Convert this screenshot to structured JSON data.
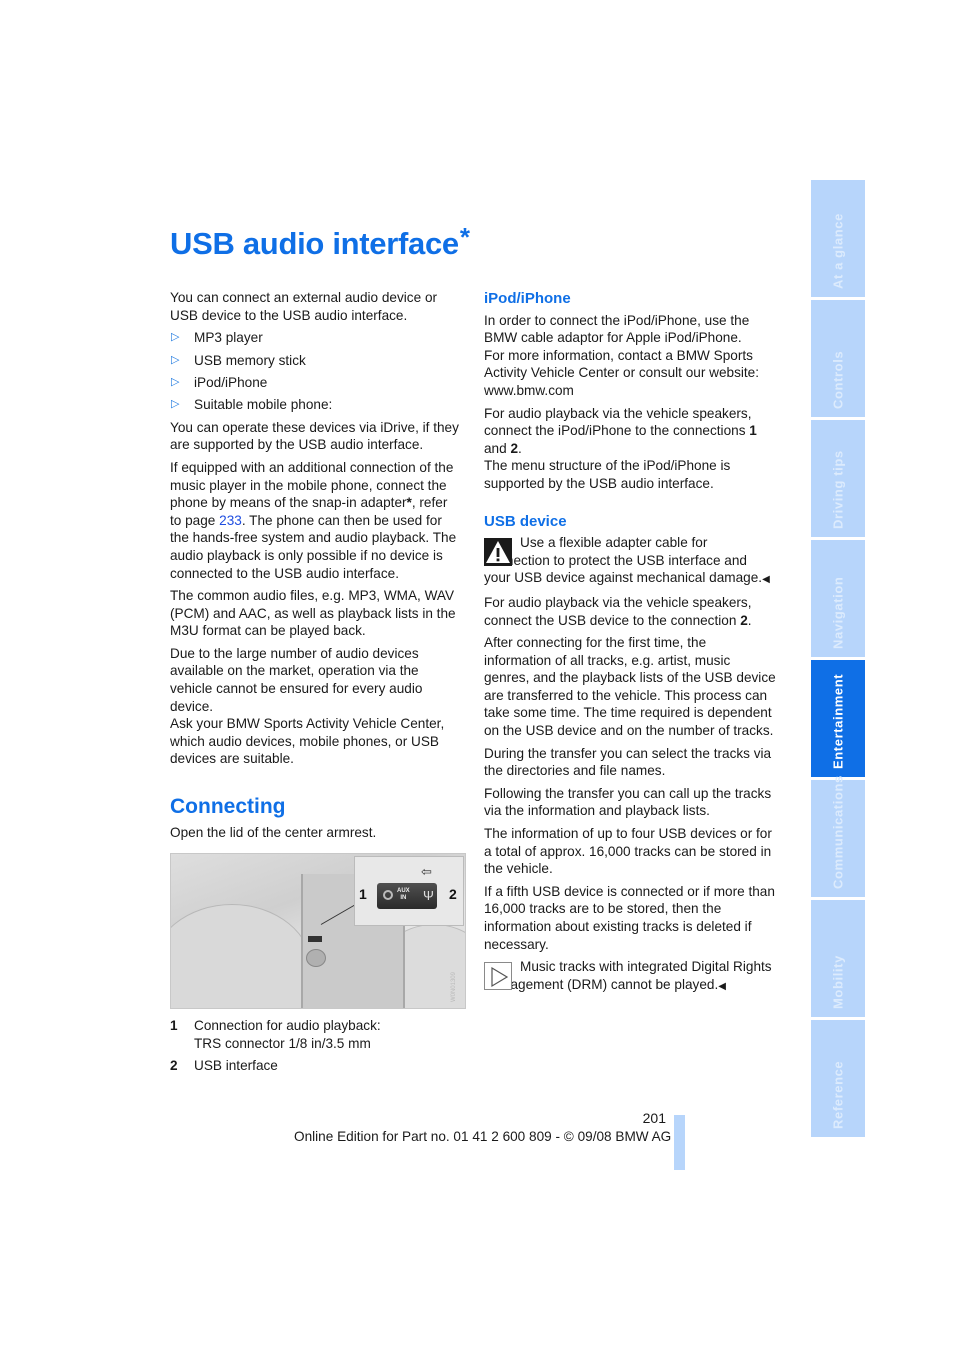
{
  "page": {
    "title": "USB audio interface",
    "title_star": "*",
    "page_number": "201",
    "footer": "Online Edition for Part no. 01 41 2 600 809 - © 09/08 BMW AG"
  },
  "colors": {
    "accent": "#0f6fe6",
    "tab_inactive": "#b7d5fb",
    "link": "#1f4de0"
  },
  "left": {
    "intro": "You can connect an external audio device or USB device to the USB audio interface.",
    "bullets": [
      "MP3 player",
      "USB memory stick",
      "iPod/iPhone",
      "Suitable mobile phone:"
    ],
    "bullet_icon": "triangle-right-icon",
    "p_idrive": "You can operate these devices via iDrive, if they are supported by the USB audio interface.",
    "p_adapter_1": "If equipped with an additional connection of the music player in the mobile phone, connect the phone by means of the snap-in adapter",
    "p_adapter_star": "*",
    "p_adapter_2": ", refer to page ",
    "p_adapter_link": "233",
    "p_adapter_3": ". The phone can then be used for the hands-free system and audio playback. The audio playback is only possible if no device is connected to the USB audio interface.",
    "p_formats": "The common audio files, e.g. MP3, WMA, WAV (PCM) and AAC, as well as playback lists in the M3U format can be played back.",
    "p_devices": "Due to the large number of audio devices available on the market, operation via the vehicle cannot be ensured for every audio device.",
    "p_devices_2": "Ask your BMW Sports Activity Vehicle Center, which audio devices, mobile phones, or USB devices are suitable.",
    "connecting_heading": "Connecting",
    "connecting_text": "Open the lid of the center armrest.",
    "figure": {
      "label_1": "1",
      "label_2": "2",
      "panel_text_1": "AUX",
      "panel_text_2": "IN",
      "usb_symbol": "Ψ",
      "image_code": "W0N01309"
    },
    "legend": [
      {
        "num": "1",
        "text": "Connection for audio playback:",
        "text2": "TRS connector 1/8 in/3.5 mm"
      },
      {
        "num": "2",
        "text": "USB interface"
      }
    ]
  },
  "right": {
    "ipod_heading": "iPod/iPhone",
    "ipod_p1": "In order to connect the iPod/iPhone, use the BMW cable adaptor for Apple iPod/iPhone.",
    "ipod_p1b": "For more information, contact a BMW Sports Activity Vehicle Center or consult our website: www.bmw.com",
    "ipod_p2_a": "For audio playback via the vehicle speakers, connect the iPod/iPhone to the connections ",
    "ipod_p2_b1": "1",
    "ipod_p2_and": " and ",
    "ipod_p2_b2": "2",
    "ipod_p2_end": ".",
    "ipod_p3": "The menu structure of the iPod/iPhone is supported by the USB audio interface.",
    "usb_heading": "USB device",
    "usb_warning": "Use a flexible adapter cable for connection to protect the USB interface and your USB device against mechanical damage.",
    "end_mark": "◀",
    "usb_p1_a": "For audio playback via the vehicle speakers, connect the USB device to the connection ",
    "usb_p1_b": "2",
    "usb_p1_end": ".",
    "usb_p2": "After connecting for the first time, the information of all tracks, e.g. artist, music genres, and the playback lists of the USB device are transferred to the vehicle. This process can take some time. The time required is dependent on the USB device and on the number of tracks.",
    "usb_p3": "During the transfer you can select the tracks via the directories and file names.",
    "usb_p4": "Following the transfer you can call up the tracks via the information and playback lists.",
    "usb_p5": "The information of up to four USB devices or for a total of approx. 16,000 tracks can be stored in the vehicle.",
    "usb_p6": "If a fifth USB device is connected or if more than 16,000 tracks are to be stored, then the information about existing tracks is deleted if necessary.",
    "usb_note": "Music tracks with integrated Digital Rights Management (DRM) cannot be played."
  },
  "sidebar": {
    "tabs": [
      {
        "label": "At a glance",
        "active": false
      },
      {
        "label": "Controls",
        "active": false
      },
      {
        "label": "Driving tips",
        "active": false
      },
      {
        "label": "Navigation",
        "active": false
      },
      {
        "label": "Entertainment",
        "active": true
      },
      {
        "label": "Communications",
        "active": false
      },
      {
        "label": "Mobility",
        "active": false
      },
      {
        "label": "Reference",
        "active": false
      }
    ]
  }
}
